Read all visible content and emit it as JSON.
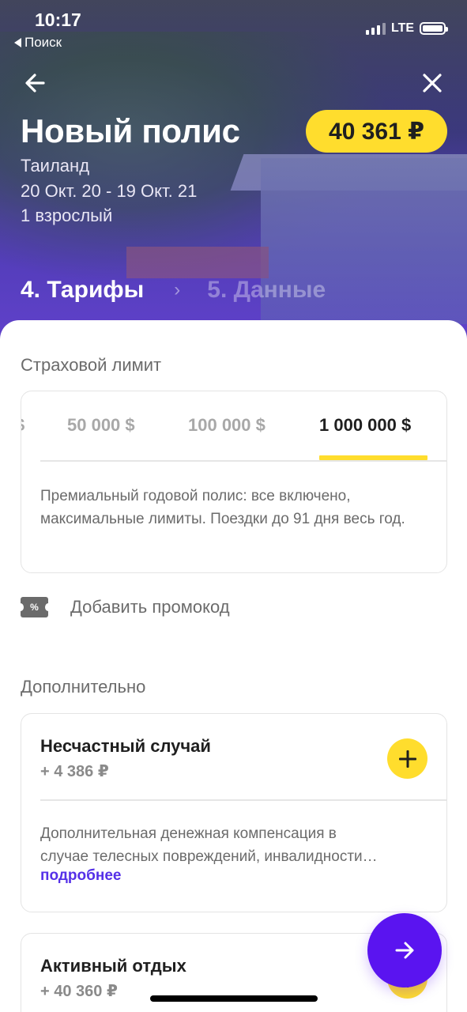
{
  "status_bar": {
    "time": "10:17",
    "back_app": "Поиск",
    "network": "LTE"
  },
  "header": {
    "title": "Новый полис",
    "price": "40 361 ₽",
    "country": "Таиланд",
    "dates": "20 Окт. 20 - 19 Окт. 21",
    "travelers": "1 взрослый",
    "step_active": "4. Тарифы",
    "step_next": "5. Данные"
  },
  "insurance_limit": {
    "label": "Страховой лимит",
    "tabs": [
      "$",
      "50 000 $",
      "100 000 $",
      "1 000 000 $"
    ],
    "selected_tab": "1 000 000 $",
    "description": "Премиальный годовой полис: все включено, максимальные лимиты. Поездки до 91 дня весь год."
  },
  "promo": {
    "icon_text": "%",
    "label": "Добавить промокод"
  },
  "additional": {
    "label": "Дополнительно",
    "options": [
      {
        "title": "Несчастный случай",
        "price": "+ 4 386 ₽",
        "description": "Дополнительная денежная компенсация в\nслучае телесных повреждений, инвалидности…",
        "more": "подробнее"
      },
      {
        "title": "Активный отдых",
        "price": "+ 40 360 ₽"
      }
    ]
  },
  "colors": {
    "accent": "#ffdd2d",
    "primary": "#5a14f0",
    "link": "#5530e8"
  }
}
